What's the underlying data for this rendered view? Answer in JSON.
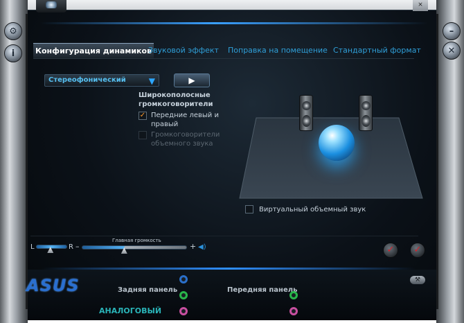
{
  "tabs": [
    {
      "label": "Конфигурация динамиков",
      "active": true
    },
    {
      "label": "Звуковой эффект",
      "active": false
    },
    {
      "label": "Поправка на помещение",
      "active": false
    },
    {
      "label": "Стандартный формат",
      "active": false
    }
  ],
  "config": {
    "dropdown_value": "Стереофонический",
    "play_icon": "play-icon",
    "section_title": "Широкополосные громкоговорители",
    "checkboxes": [
      {
        "label": "Передние левый и правый",
        "checked": true,
        "enabled": true
      },
      {
        "label": "Громкоговорители объемного звука",
        "checked": false,
        "enabled": false
      }
    ],
    "virtual_surround_label": "Виртуальный объемный звук",
    "virtual_surround_checked": false
  },
  "volume": {
    "title": "Главная громкость",
    "left_label": "L",
    "right_label": "R",
    "minus": "–",
    "plus": "+",
    "level": 0.4,
    "balance": 0.45
  },
  "bottom": {
    "logo": "ASUS",
    "rear_label": "Задняя панель",
    "front_label": "Передняя панель",
    "analog_label": "АНАЛОГОВЫЙ"
  },
  "colors": {
    "accent": "#2f9fd8",
    "jack_blue": "#2a6fc9",
    "jack_green": "#28b54a",
    "jack_pink": "#c84fa0"
  }
}
